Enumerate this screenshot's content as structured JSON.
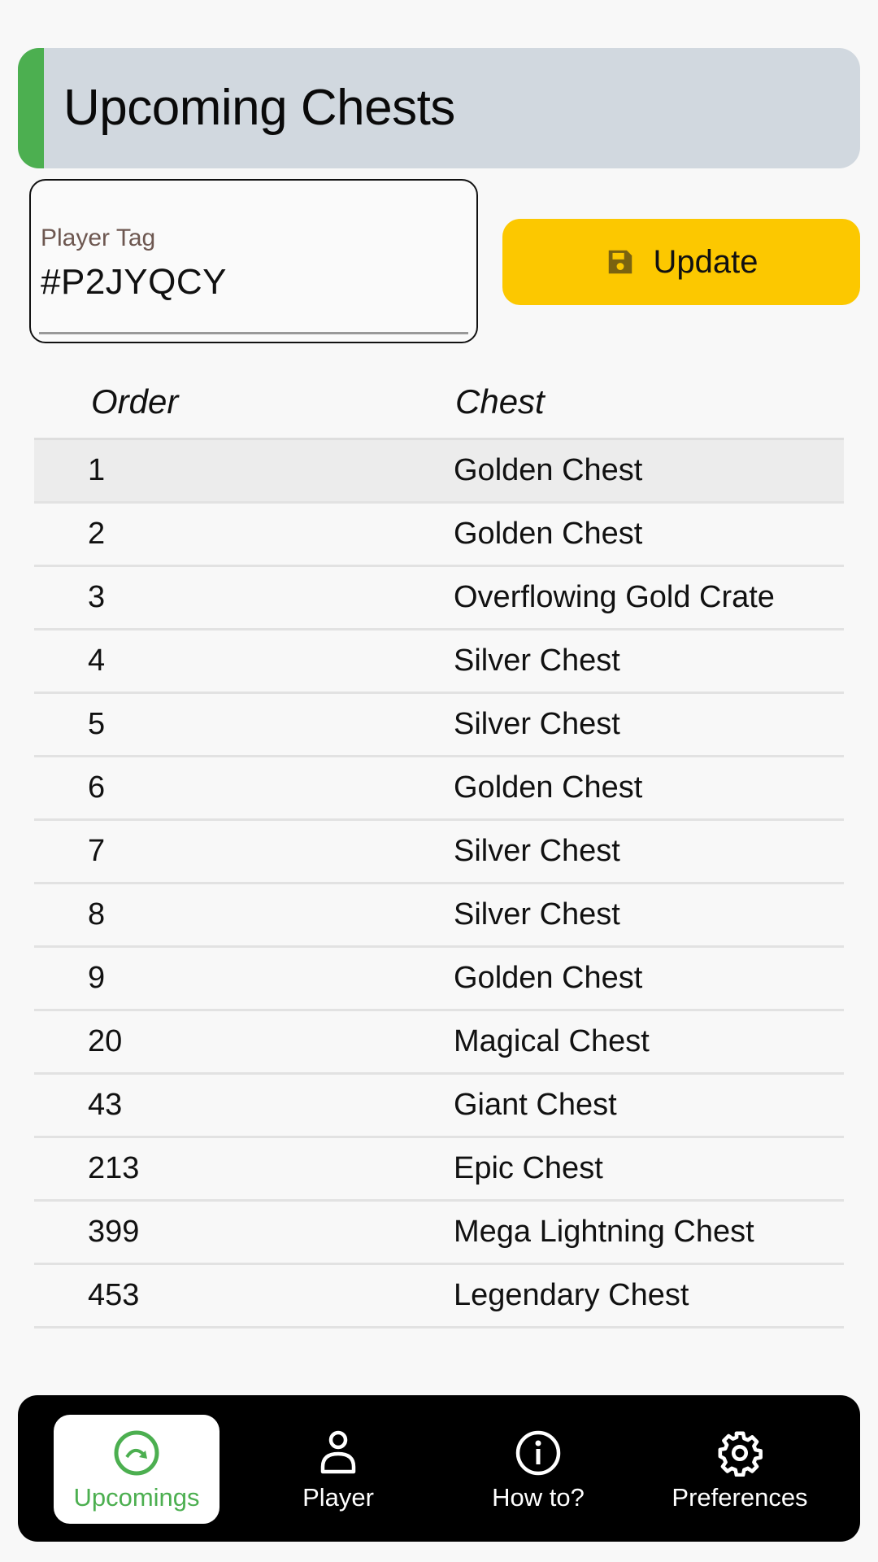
{
  "header": {
    "title": "Upcoming Chests",
    "accent_color": "#4caf50"
  },
  "player_tag": {
    "label": "Player Tag",
    "value": "#P2JYQCY"
  },
  "update_button": {
    "label": "Update",
    "icon": "save-icon",
    "color": "#fcc800"
  },
  "table": {
    "columns": [
      "Order",
      "Chest"
    ],
    "rows": [
      {
        "order": "1",
        "chest": "Golden Chest"
      },
      {
        "order": "2",
        "chest": "Golden Chest"
      },
      {
        "order": "3",
        "chest": "Overflowing Gold Crate"
      },
      {
        "order": "4",
        "chest": "Silver Chest"
      },
      {
        "order": "5",
        "chest": "Silver Chest"
      },
      {
        "order": "6",
        "chest": "Golden Chest"
      },
      {
        "order": "7",
        "chest": "Silver Chest"
      },
      {
        "order": "8",
        "chest": "Silver Chest"
      },
      {
        "order": "9",
        "chest": "Golden Chest"
      },
      {
        "order": "20",
        "chest": "Magical Chest"
      },
      {
        "order": "43",
        "chest": "Giant Chest"
      },
      {
        "order": "213",
        "chest": "Epic Chest"
      },
      {
        "order": "399",
        "chest": "Mega Lightning Chest"
      },
      {
        "order": "453",
        "chest": "Legendary Chest"
      }
    ]
  },
  "nav": {
    "items": [
      {
        "label": "Upcomings",
        "icon": "upcoming-icon",
        "active": true
      },
      {
        "label": "Player",
        "icon": "person-icon",
        "active": false
      },
      {
        "label": "How to?",
        "icon": "info-icon",
        "active": false
      },
      {
        "label": "Preferences",
        "icon": "gear-icon",
        "active": false
      }
    ]
  }
}
